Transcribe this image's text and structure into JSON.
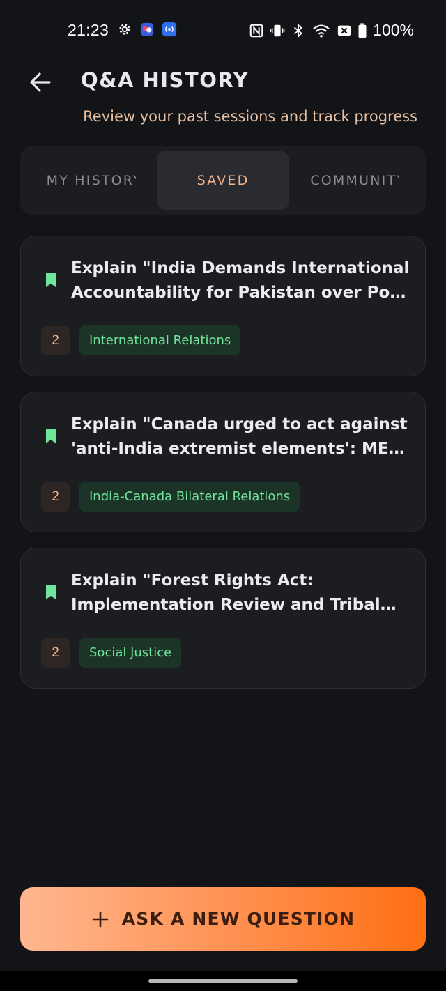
{
  "status_bar": {
    "time": "21:23",
    "battery": "100%",
    "left_icons": [
      "settings-gear-icon",
      "app-notification-icon",
      "broadcast-icon"
    ],
    "right_icons": [
      "nfc-icon",
      "vibrate-icon",
      "bluetooth-icon",
      "wifi-icon",
      "close-box-icon",
      "battery-icon"
    ]
  },
  "header": {
    "back_icon": "back-arrow-icon",
    "title": "Q&A HISTORY",
    "subtitle": "Review your past sessions and track progress"
  },
  "tabs": [
    {
      "label": "MY HISTORY",
      "active": false
    },
    {
      "label": "SAVED",
      "active": true
    },
    {
      "label": "COMMUNITY",
      "active": false
    }
  ],
  "cards": [
    {
      "title": "Explain \"India Demands International Accountability for Pakistan over PoK Rights Violations\"",
      "count": "2",
      "tag": "International Relations"
    },
    {
      "title": "Explain \"Canada urged to act against 'anti-India extremist elements': MEA\" in detail",
      "count": "2",
      "tag": "India-Canada Bilateral Relations"
    },
    {
      "title": "Explain \"Forest Rights Act: Implementation Review and Tribal Welfare\"",
      "count": "2",
      "tag": "Social Justice"
    }
  ],
  "ask_button": {
    "label": "ASK A NEW QUESTION",
    "icon": "plus-icon"
  },
  "colors": {
    "background": "#131417",
    "card": "#1c1d21",
    "accent_orange": "#f3b48a",
    "tag_green": "#72e39a",
    "bookmark_green": "#6ee79a"
  }
}
